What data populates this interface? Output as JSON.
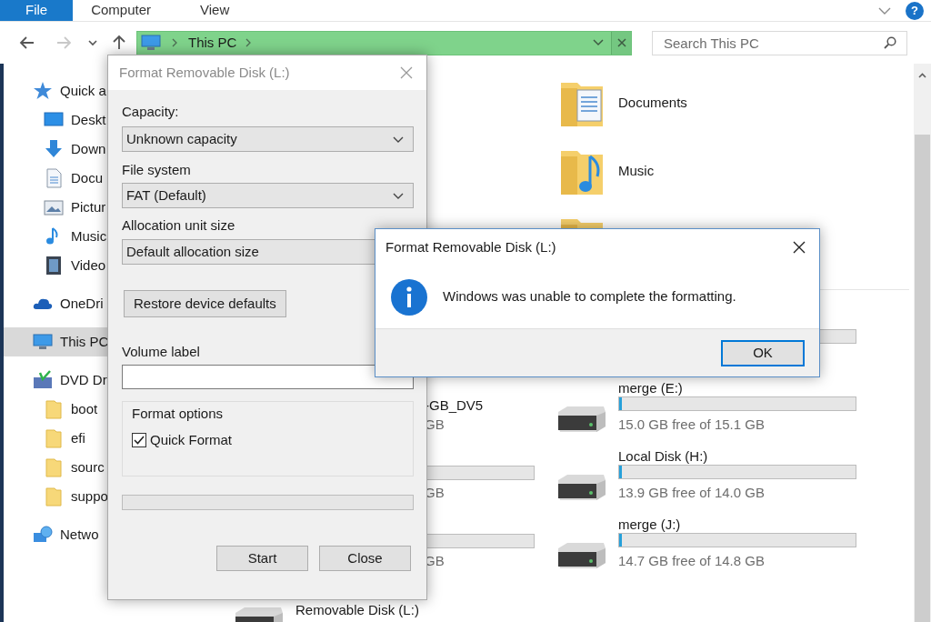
{
  "ribbon": {
    "tabs": [
      {
        "label": "File",
        "selected": true
      },
      {
        "label": "Computer",
        "selected": false
      },
      {
        "label": "View",
        "selected": false
      }
    ],
    "help": "?"
  },
  "nav_buttons": [
    {
      "kind": "back",
      "disabled": false
    },
    {
      "kind": "forward",
      "disabled": true
    },
    {
      "kind": "recent",
      "disabled": false
    },
    {
      "kind": "up",
      "disabled": false
    }
  ],
  "address_bar": {
    "path": "This PC"
  },
  "search": {
    "placeholder": "Search This PC"
  },
  "sidebar": {
    "items": [
      {
        "label": "Quick a",
        "kind": "star",
        "selected": false,
        "children": [
          {
            "label": "Deskt",
            "kind": "desktop",
            "selected": false
          },
          {
            "label": "Down",
            "kind": "download",
            "selected": false
          },
          {
            "label": "Docu",
            "kind": "document",
            "selected": false
          },
          {
            "label": "Pictur",
            "kind": "picture",
            "selected": false
          },
          {
            "label": "Music",
            "kind": "music",
            "selected": false
          },
          {
            "label": "Video",
            "kind": "video",
            "selected": false
          }
        ]
      },
      {
        "label": "OneDri",
        "kind": "cloud",
        "selected": false
      },
      {
        "label": "This PC",
        "kind": "pc",
        "selected": true
      },
      {
        "label": "DVD Dr",
        "kind": "dvd",
        "selected": false,
        "children": [
          {
            "label": "boot",
            "kind": "folder",
            "selected": false
          },
          {
            "label": "efi",
            "kind": "folder",
            "selected": false
          },
          {
            "label": "sourc",
            "kind": "folder",
            "selected": false
          },
          {
            "label": "suppo",
            "kind": "folder",
            "selected": false
          }
        ]
      },
      {
        "label": "Netwo",
        "kind": "network",
        "selected": false
      }
    ]
  },
  "content": {
    "folders": [
      {
        "label": "Documents",
        "kind": "documents"
      },
      {
        "label": "Music",
        "kind": "music"
      }
    ],
    "partial_drives": [
      {
        "name": "-GB_DV5",
        "detail": "GB",
        "bar": false
      },
      {
        "detail": "GB",
        "bar": true
      },
      {
        "detail": "GB",
        "bar": true
      }
    ],
    "drives": [
      {
        "name": "merge (E:)",
        "level": 0.01,
        "detail": "15.0 GB free of 15.1 GB"
      },
      {
        "name": "Local Disk (H:)",
        "level": 0.01,
        "detail": "13.9 GB free of 14.0 GB"
      },
      {
        "name": "merge (J:)",
        "level": 0.01,
        "detail": "14.7 GB free of 14.8 GB"
      }
    ],
    "bottom_drive": {
      "name": "Removable Disk (L:)"
    }
  },
  "format_dialog": {
    "title": "Format Removable Disk (L:)",
    "active": false,
    "capacity": {
      "label": "Capacity:",
      "value": "Unknown capacity"
    },
    "file_system": {
      "label": "File system",
      "value": "FAT (Default)"
    },
    "allocation": {
      "label": "Allocation unit size",
      "value": "Default allocation size"
    },
    "restore_button": "Restore device defaults",
    "volume_label": {
      "label": "Volume label"
    },
    "format_options": {
      "title": "Format options",
      "quick_format": {
        "label": "Quick Format",
        "checked": true
      }
    },
    "progress": {
      "level": 0
    },
    "buttons": [
      "Start",
      "Close"
    ]
  },
  "message_box": {
    "title": "Format Removable Disk (L:)",
    "message": "Windows was unable to complete the formatting.",
    "button": "OK"
  }
}
